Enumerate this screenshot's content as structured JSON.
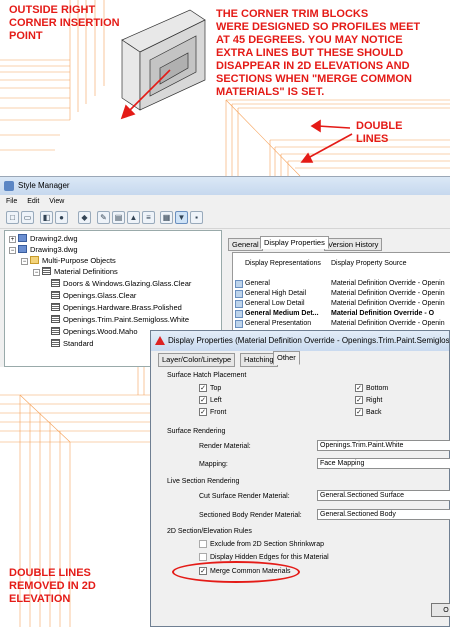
{
  "annotations": {
    "top_left": "OUTSIDE RIGHT\nCORNER INSERTION\nPOINT",
    "top_right": "THE CORNER TRIM BLOCKS\nWERE DESIGNED SO PROFILES MEET\nAT 45 DEGREES.  YOU MAY NOTICE\nEXTRA LINES BUT THESE SHOULD\nDISAPPEAR IN 2D ELEVATIONS AND\nSECTIONS WHEN \"MERGE COMMON\nMATERIALS\" IS SET.",
    "double_lines": "DOUBLE\nLINES",
    "bottom_left": "DOUBLE LINES\nREMOVED IN 2D\nELEVATION"
  },
  "colors": {
    "annotation": "#e41b17",
    "cad_lines": "#f6a25a"
  },
  "style_manager": {
    "title": "Style Manager",
    "menu": [
      "File",
      "Edit",
      "View"
    ],
    "tree": [
      {
        "label": "Drawing2.dwg",
        "icon": "drawing-icon"
      },
      {
        "label": "Drawing3.dwg",
        "icon": "drawing-icon"
      },
      {
        "label": "Multi-Purpose Objects",
        "icon": "folder-icon"
      },
      {
        "label": "Material Definitions",
        "icon": "material-icon"
      },
      {
        "label": "Doors & Windows.Glazing.Glass.Clear",
        "icon": "material-icon"
      },
      {
        "label": "Openings.Glass.Clear",
        "icon": "material-icon"
      },
      {
        "label": "Openings.Hardware.Brass.Polished",
        "icon": "material-icon"
      },
      {
        "label": "Openings.Trim.Paint.Semigloss.White",
        "icon": "material-icon"
      },
      {
        "label": "Openings.Wood.Maho",
        "icon": "material-icon"
      },
      {
        "label": "Standard",
        "icon": "material-icon"
      }
    ],
    "tabs": [
      "General",
      "Display Properties",
      "Version History"
    ],
    "columns": [
      "Display Representations",
      "Display Property Source"
    ],
    "rows": [
      [
        "General",
        "Material Definition Override - Openin"
      ],
      [
        "General High Detail",
        "Material Definition Override - Openin"
      ],
      [
        "General Low Detail",
        "Material Definition Override - Openin"
      ],
      [
        "General Medium Det...",
        "Material Definition Override - O"
      ],
      [
        "General Presentation",
        "Material Definition Override - Openin"
      ]
    ]
  },
  "display_properties": {
    "title": "Display Properties (Material Definition Override - Openings.Trim.Paint.Semigloss",
    "tabs": [
      "Layer/Color/Linetype",
      "Hatching",
      "Other"
    ],
    "surface_hatch_placement": "Surface Hatch Placement",
    "top": "Top",
    "left": "Left",
    "front": "Front",
    "bottom": "Bottom",
    "right": "Right",
    "back": "Back",
    "surface_rendering": "Surface Rendering",
    "render_material_label": "Render Material:",
    "render_material_value": "Openings.Trim.Paint.White",
    "mapping_label": "Mapping:",
    "mapping_value": "Face Mapping",
    "live_section_rendering": "Live Section Rendering",
    "cut_surface_label": "Cut Surface Render Material:",
    "cut_surface_value": "General.Sectioned Surface",
    "sectioned_body_label": "Sectioned Body Render Material:",
    "sectioned_body_value": "General.Sectioned Body",
    "section_rules": "2D Section/Elevation Rules",
    "exclude_label": "Exclude from 2D Section Shrinkwrap",
    "hidden_edges_label": "Display Hidden Edges for this Material",
    "merge_label": "Merge Common Materials",
    "ok_label": "O"
  }
}
